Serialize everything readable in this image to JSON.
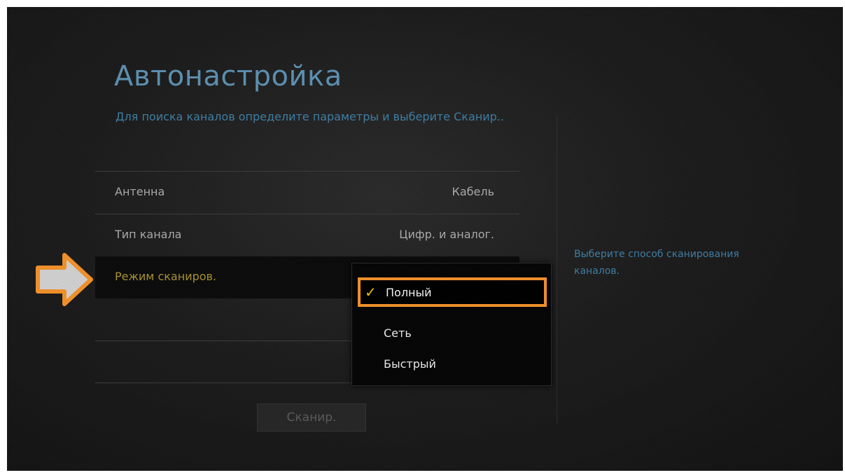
{
  "page": {
    "title": "Автонастройка",
    "subtitle": "Для поиска каналов определите параметры и выберите Сканир..",
    "help_text": "Выберите способ сканирования каналов."
  },
  "settings": [
    {
      "label": "Антенна",
      "value": "Кабель"
    },
    {
      "label": "Тип канала",
      "value": "Цифр. и аналог."
    },
    {
      "label": "Режим сканиров.",
      "value": ""
    }
  ],
  "dropdown": {
    "options": [
      "Полный",
      "Сеть",
      "Быстрый"
    ],
    "selected": "Полный"
  },
  "scan_button": {
    "label": "Сканир."
  },
  "icons": {
    "check": "✓",
    "pointer": "arrow-right-icon"
  },
  "colors": {
    "title": "#5c8fb0",
    "active_label": "#a8922f",
    "highlight": "#f0902a",
    "check": "#f0c000"
  }
}
